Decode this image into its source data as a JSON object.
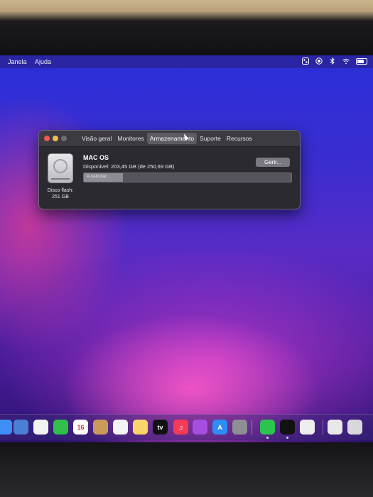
{
  "menubar": {
    "items": [
      "Janela",
      "Ajuda"
    ],
    "status_icons": [
      "control-center-icon",
      "screen-record-icon",
      "bluetooth-icon",
      "wifi-icon",
      "battery-icon"
    ]
  },
  "window": {
    "tabs": [
      {
        "label": "Visão geral",
        "active": false
      },
      {
        "label": "Monitores",
        "active": false
      },
      {
        "label": "Armazenamento",
        "active": true
      },
      {
        "label": "Suporte",
        "active": false
      },
      {
        "label": "Recursos",
        "active": false
      }
    ],
    "disk_label_line1": "Disco flash:",
    "disk_label_line2": "251 GB",
    "volume_name": "MAC OS",
    "available": "Disponível: 203,45 GB (de 250,69 GB)",
    "manage_button": "Gerir...",
    "progress_text": "A calcular...",
    "progress_fraction": 0.19
  },
  "dock": {
    "apps": [
      {
        "name": "mail-icon",
        "label": "",
        "color": "#3d8ff5"
      },
      {
        "name": "preview-icon",
        "label": "",
        "color": "#4a7fd6"
      },
      {
        "name": "photos-icon",
        "label": "",
        "color": "#f2f2f2"
      },
      {
        "name": "facetime-icon",
        "label": "",
        "color": "#2fbf4a"
      },
      {
        "name": "calendar-icon",
        "label": "16",
        "color": "#ffffff"
      },
      {
        "name": "contacts-icon",
        "label": "",
        "color": "#c99a5b"
      },
      {
        "name": "reminders-icon",
        "label": "",
        "color": "#f4f4f4"
      },
      {
        "name": "notes-icon",
        "label": "",
        "color": "#f7d56a"
      },
      {
        "name": "apple-tv-icon",
        "label": "tv",
        "color": "#111111"
      },
      {
        "name": "music-icon",
        "label": "♫",
        "color": "#f43a54"
      },
      {
        "name": "podcasts-icon",
        "label": "",
        "color": "#a54ee0"
      },
      {
        "name": "app-store-icon",
        "label": "A",
        "color": "#2c8df5"
      },
      {
        "name": "system-preferences-icon",
        "label": "",
        "color": "#8e8e94"
      },
      {
        "name": "whatsapp-icon",
        "label": "",
        "color": "#2cc44f"
      },
      {
        "name": "spotify-icon",
        "label": "",
        "color": "#121212"
      },
      {
        "name": "textedit-icon",
        "label": "",
        "color": "#eeeeee"
      },
      {
        "name": "downloads-icon",
        "label": "",
        "color": "#e8e8e8"
      },
      {
        "name": "trash-icon",
        "label": "",
        "color": "#d8d8dc"
      }
    ]
  }
}
